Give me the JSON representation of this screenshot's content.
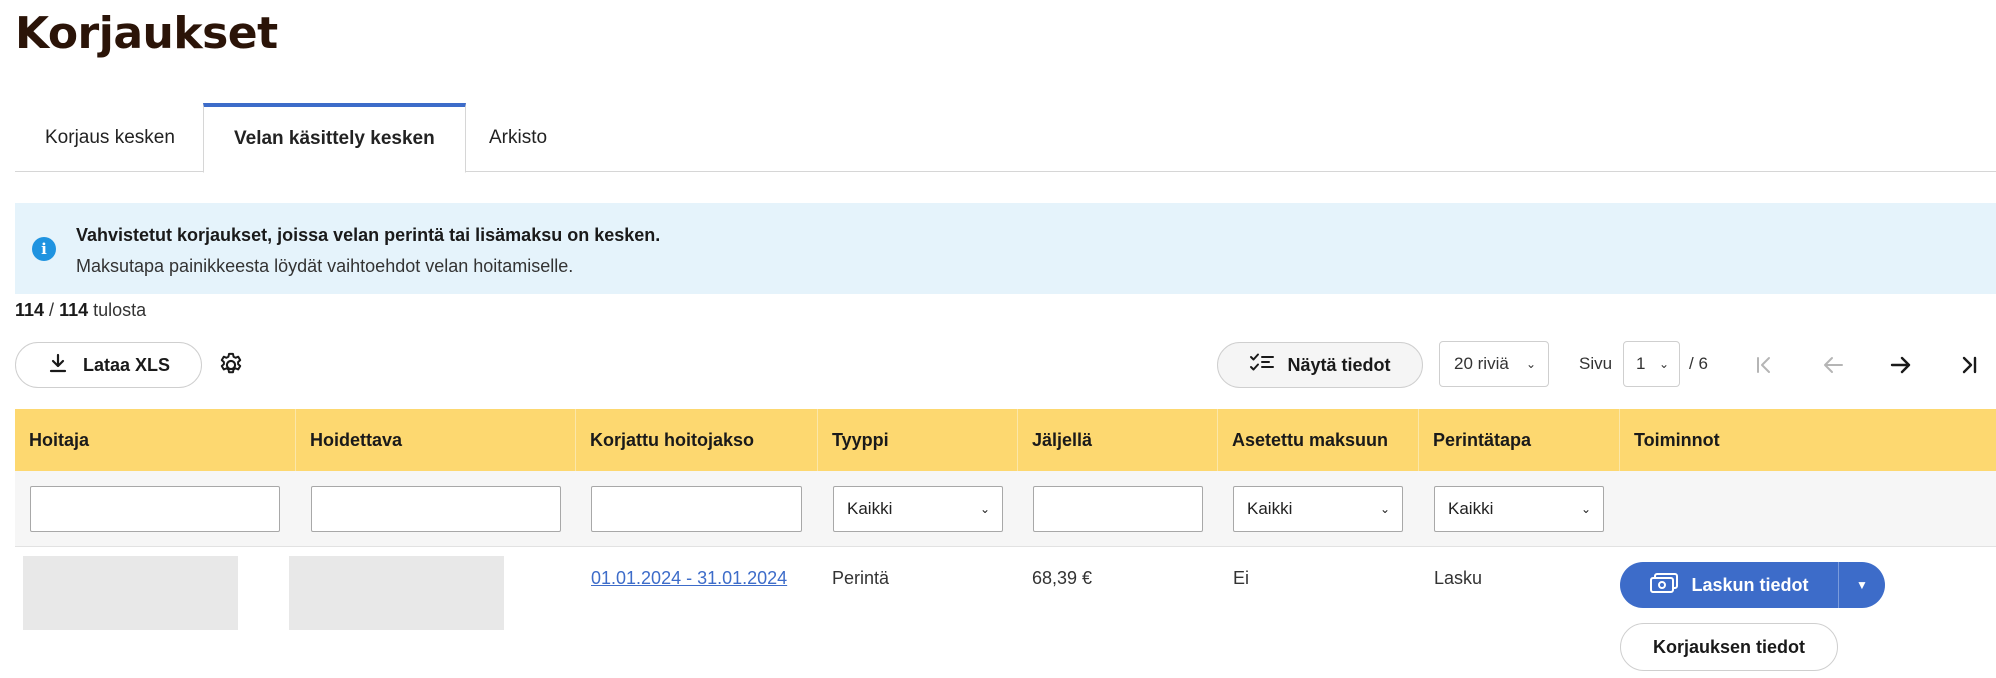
{
  "page": {
    "title": "Korjaukset"
  },
  "tabs": [
    {
      "label": "Korjaus kesken"
    },
    {
      "label": "Velan käsittely kesken",
      "active": true
    },
    {
      "label": "Arkisto"
    }
  ],
  "info": {
    "title": "Vahvistetut korjaukset, joissa velan perintä tai lisämaksu on kesken.",
    "text": "Maksutapa painikkeesta löydät vaihtoehdot velan hoitamiselle."
  },
  "results": {
    "shown": "114",
    "total": "114",
    "suffix": "tulosta"
  },
  "toolbar": {
    "download_label": "Lataa XLS",
    "show_details_label": "Näytä tiedot",
    "rows_per_page": "20 riviä",
    "page_label": "Sivu",
    "current_page": "1",
    "total_pages": "/ 6"
  },
  "table": {
    "headers": [
      "Hoitaja",
      "Hoidettava",
      "Korjattu hoitojakso",
      "Tyyppi",
      "Jäljellä",
      "Asetettu maksuun",
      "Perintätapa",
      "Toiminnot"
    ],
    "filters": {
      "tyyppi": "Kaikki",
      "asetettu_maksuun": "Kaikki",
      "perintatapa": "Kaikki"
    },
    "rows": [
      {
        "hoitojakso": "01.01.2024 - 31.01.2024",
        "tyyppi": "Perintä",
        "jaljella": "68,39 €",
        "asetettu_maksuun": "Ei",
        "perintatapa": "Lasku",
        "invoice_button": "Laskun tiedot",
        "details_button": "Korjauksen tiedot"
      }
    ]
  },
  "colors": {
    "header_bg": "#fdd870",
    "accent_blue": "#3d6cc9",
    "info_bg": "#e5f3fb",
    "title_brown": "#2b1408"
  },
  "icons": [
    "info-icon",
    "download-icon",
    "gear-icon",
    "checklist-icon",
    "chevron-down-icon",
    "first-page-icon",
    "prev-page-icon",
    "next-page-icon",
    "last-page-icon",
    "invoice-icon"
  ]
}
